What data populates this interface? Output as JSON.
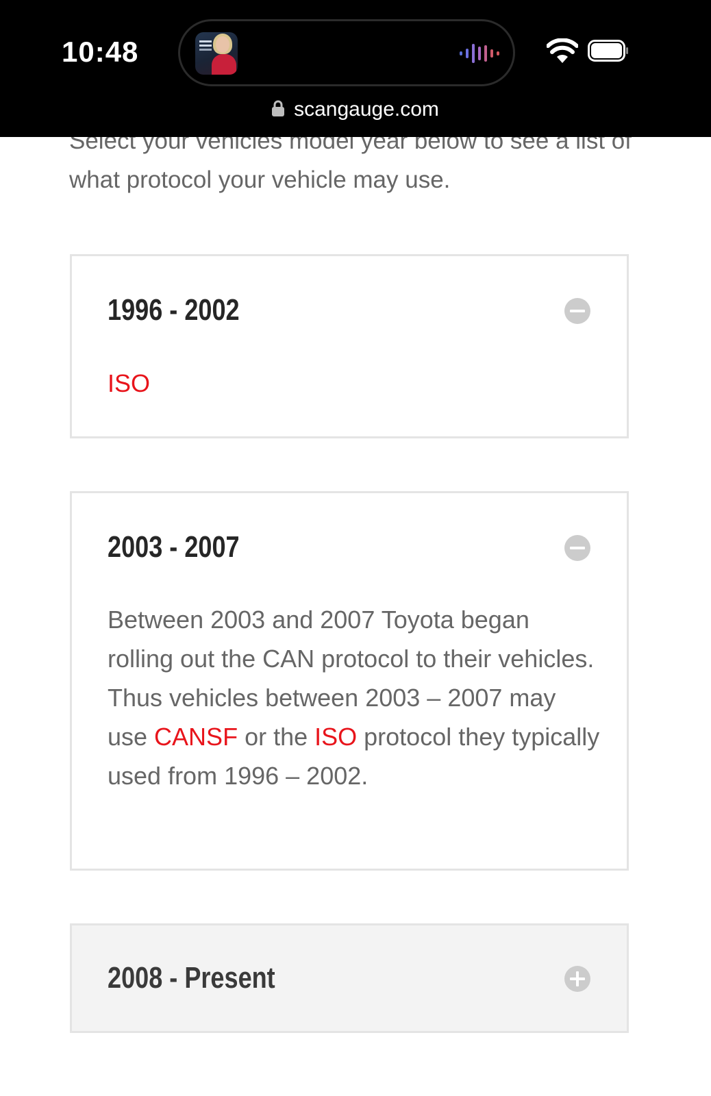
{
  "status_bar": {
    "time": "10:48",
    "url": "scangauge.com"
  },
  "colors": {
    "link_red": "#e8141b",
    "body_text": "#666666",
    "heading_text": "#262626",
    "border": "#e4e4e4",
    "collapsed_bg": "#f3f3f3"
  },
  "intro_text": "Select your vehicles model year below to see a list of what protocol your vehicle may use.",
  "accordions": [
    {
      "title": "1996 - 2002",
      "state": "expanded",
      "icon": "minus-circle-icon",
      "body": {
        "protocol": "ISO"
      }
    },
    {
      "title": "2003 - 2007",
      "state": "expanded",
      "icon": "minus-circle-icon",
      "body": {
        "text_1": "Between 2003 and 2007 Toyota began rolling out the CAN protocol to their vehicles.  Thus vehicles between 2003 – 2007 may use ",
        "link_1": "CANSF",
        "text_2": " or the ",
        "link_2": "ISO",
        "text_3": " protocol they typically used from 1996 – 2002."
      }
    },
    {
      "title": "2008 - Present",
      "state": "collapsed",
      "icon": "plus-circle-icon"
    }
  ]
}
